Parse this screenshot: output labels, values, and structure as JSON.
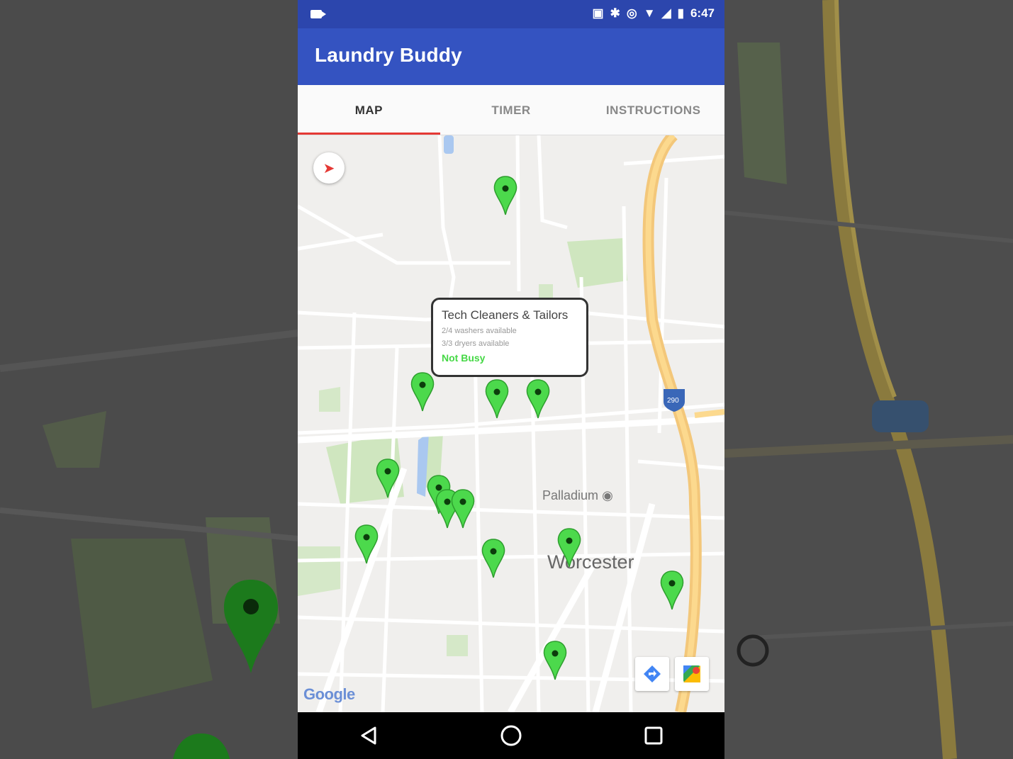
{
  "app": {
    "title": "Laundry Buddy",
    "theme_color": "#3453c1",
    "status_color": "#2c46ad"
  },
  "status_bar": {
    "time": "6:47",
    "icons": [
      "video-icon",
      "vibrate-icon",
      "bluetooth-icon",
      "sync-icon",
      "wifi-icon",
      "signal-icon",
      "battery-icon"
    ]
  },
  "tabs": [
    {
      "label": "MAP",
      "active": true
    },
    {
      "label": "TIMER",
      "active": false
    },
    {
      "label": "INSTRUCTIONS",
      "active": false
    }
  ],
  "map": {
    "place_labels": [
      "Palladium",
      "Worcester"
    ],
    "highway_shield": "290",
    "attribution": "Google",
    "pin_color": "#4cd94c",
    "info_window": {
      "name": "Tech Cleaners & Tailors",
      "line1": "2/4 washers available",
      "line2": "3/3 dryers available",
      "status": "Not Busy"
    }
  },
  "nav": {
    "back": "back-icon",
    "home": "home-icon",
    "recents": "recents-icon"
  }
}
